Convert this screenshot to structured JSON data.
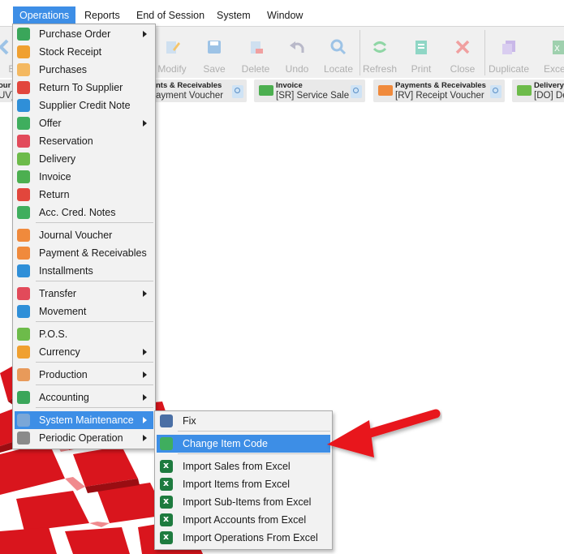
{
  "menubar": {
    "items": [
      "Operations",
      "Reports",
      "End of Session",
      "System",
      "Window"
    ]
  },
  "toolbar": {
    "buttons": [
      {
        "label": "Bac",
        "icon": "back-arrow-icon"
      },
      {
        "label": "Modify",
        "icon": "modify-icon"
      },
      {
        "label": "Save",
        "icon": "save-icon"
      },
      {
        "label": "Delete",
        "icon": "delete-icon"
      },
      {
        "label": "Undo",
        "icon": "undo-icon"
      },
      {
        "label": "Locate",
        "icon": "locate-icon"
      },
      {
        "label": "Refresh",
        "icon": "refresh-icon"
      },
      {
        "label": "Print",
        "icon": "print-icon"
      },
      {
        "label": "Close",
        "icon": "close-icon"
      },
      {
        "label": "Duplicate",
        "icon": "duplicate-icon"
      },
      {
        "label": "Excel",
        "icon": "excel-icon"
      }
    ]
  },
  "quick_access": [
    {
      "title": "our",
      "subtitle": "UV]"
    },
    {
      "title": "nts & Receivables",
      "subtitle": "ayment Voucher"
    },
    {
      "title": "Invoice",
      "subtitle": "[SR] Service Sale"
    },
    {
      "title": "Payments & Receivables",
      "subtitle": "[RV] Receipt Voucher"
    },
    {
      "title": "Delivery",
      "subtitle": "[DO] De"
    }
  ],
  "operations_menu": {
    "items": [
      {
        "label": "Purchase Order",
        "icon": "purchase-order-icon",
        "submenu": true
      },
      {
        "label": "Stock Receipt",
        "icon": "stock-receipt-icon",
        "submenu": false
      },
      {
        "label": "Purchases",
        "icon": "purchases-icon",
        "submenu": false
      },
      {
        "label": "Return To Supplier",
        "icon": "return-to-supplier-icon",
        "submenu": false
      },
      {
        "label": "Supplier Credit Note",
        "icon": "supplier-credit-note-icon",
        "submenu": false
      },
      {
        "label": "Offer",
        "icon": "offer-icon",
        "submenu": true
      },
      {
        "label": "Reservation",
        "icon": "reservation-icon",
        "submenu": false
      },
      {
        "label": "Delivery",
        "icon": "delivery-icon",
        "submenu": false
      },
      {
        "label": "Invoice",
        "icon": "invoice-icon",
        "submenu": false
      },
      {
        "label": "Return",
        "icon": "return-icon",
        "submenu": false
      },
      {
        "label": "Acc. Cred. Notes",
        "icon": "acc-cred-notes-icon",
        "submenu": false
      },
      {
        "label": "Journal Voucher",
        "icon": "journal-voucher-icon",
        "submenu": false
      },
      {
        "label": "Payment & Receivables",
        "icon": "payment-receivables-icon",
        "submenu": false
      },
      {
        "label": "Installments",
        "icon": "installments-icon",
        "submenu": false
      },
      {
        "label": "Transfer",
        "icon": "transfer-icon",
        "submenu": true
      },
      {
        "label": "Movement",
        "icon": "movement-icon",
        "submenu": false
      },
      {
        "label": "P.O.S.",
        "icon": "pos-icon",
        "submenu": false
      },
      {
        "label": "Currency",
        "icon": "currency-icon",
        "submenu": true
      },
      {
        "label": "Production",
        "icon": "production-icon",
        "submenu": true
      },
      {
        "label": "Accounting",
        "icon": "accounting-icon",
        "submenu": true
      },
      {
        "label": "System Maintenance",
        "icon": "system-maintenance-icon",
        "submenu": true
      },
      {
        "label": "Periodic Operation",
        "icon": "periodic-operation-icon",
        "submenu": true
      }
    ]
  },
  "system_maintenance_submenu": {
    "items": [
      {
        "label": "Fix",
        "icon": "laptop-icon"
      },
      {
        "label": "Change Item Code",
        "icon": "change-item-code-icon"
      },
      {
        "label": "Import Sales from Excel",
        "icon": "excel-icon"
      },
      {
        "label": "Import Items from Excel",
        "icon": "excel-icon"
      },
      {
        "label": "Import Sub-Items from Excel",
        "icon": "excel-icon"
      },
      {
        "label": "Import Accounts from Excel",
        "icon": "excel-icon"
      },
      {
        "label": "Import Operations From Excel",
        "icon": "excel-icon"
      }
    ]
  },
  "colors": {
    "highlight": "#3d8ee6",
    "menu_bg": "#f2f2f2",
    "annotation_arrow": "#e8141b",
    "background_art": "#d9151d"
  }
}
